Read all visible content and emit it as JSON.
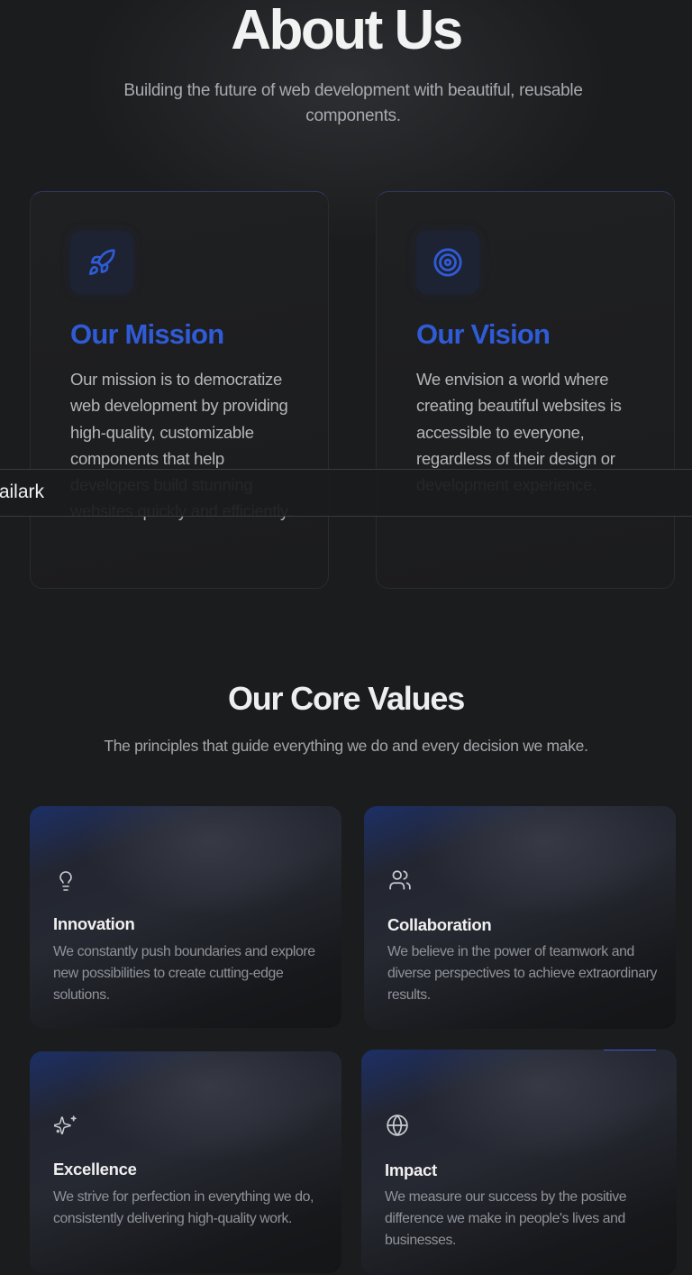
{
  "hero": {
    "title": "About Us",
    "subtitle": "Building the future of web development with beautiful, reusable components."
  },
  "mission": {
    "icon": "rocket-icon",
    "title": "Our Mission",
    "text": "Our mission is to democratize web development by providing high-quality, customizable components that help developers build stunning websites quickly and efficiently."
  },
  "vision": {
    "icon": "target-icon",
    "title": "Our Vision",
    "text": "We envision a world where creating beautiful websites is accessible to everyone, regardless of their design or development experience."
  },
  "navbar": {
    "brand": "tailark"
  },
  "core_values": {
    "title": "Our Core Values",
    "subtitle": "The principles that guide everything we do and every decision we make.",
    "items": [
      {
        "icon": "lightbulb-icon",
        "title": "Innovation",
        "text": "We constantly push boundaries and explore new possibilities to create cutting-edge solutions."
      },
      {
        "icon": "users-icon",
        "title": "Collaboration",
        "text": "We believe in the power of teamwork and diverse perspectives to achieve extraordinary results."
      },
      {
        "icon": "sparkles-icon",
        "title": "Excellence",
        "text": "We strive for perfection in everything we do, consistently delivering high-quality work."
      },
      {
        "icon": "globe-icon",
        "title": "Impact",
        "text": "We measure our success by the positive difference we make in people's lives and businesses."
      }
    ]
  },
  "colors": {
    "background": "#1b1c1e",
    "accent": "#2f5bd6",
    "heading": "#f2f2f2",
    "muted": "#a9abb0"
  }
}
